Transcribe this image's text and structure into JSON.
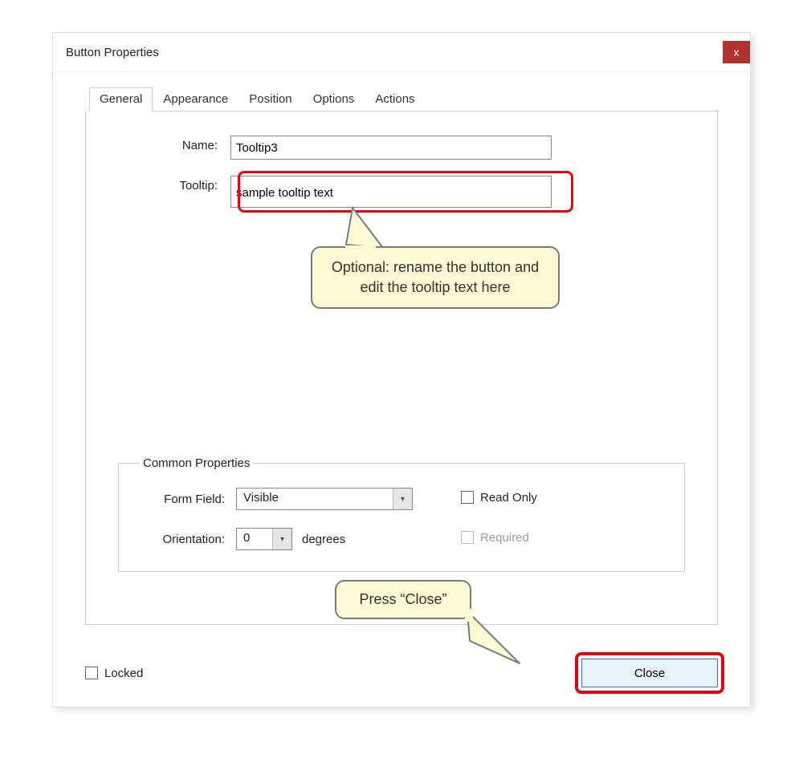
{
  "dialog": {
    "title": "Button Properties",
    "close_x": "x"
  },
  "tabs": {
    "general": "General",
    "appearance": "Appearance",
    "position": "Position",
    "options": "Options",
    "actions": "Actions"
  },
  "general": {
    "name_label": "Name:",
    "name_value": "Tooltip3",
    "tooltip_label": "Tooltip:",
    "tooltip_value": "sample tooltip text"
  },
  "common": {
    "legend": "Common Properties",
    "form_field_label": "Form Field:",
    "form_field_value": "Visible",
    "read_only_label": "Read Only",
    "orientation_label": "Orientation:",
    "orientation_value": "0",
    "degrees_label": "degrees",
    "required_label": "Required"
  },
  "callouts": {
    "main": "Optional: rename the button and edit the tooltip text here",
    "close": "Press “Close”"
  },
  "footer": {
    "locked_label": "Locked",
    "close_label": "Close"
  }
}
